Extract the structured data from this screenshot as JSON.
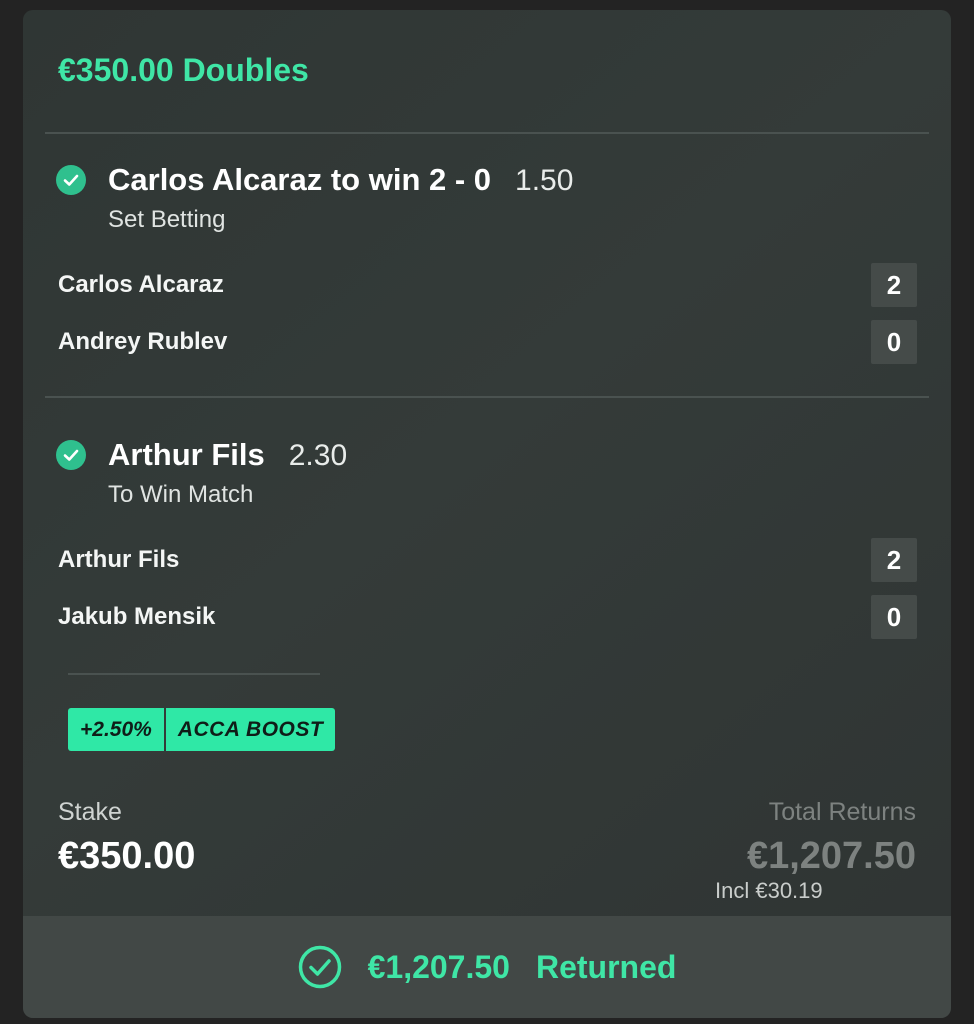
{
  "bet": {
    "title": "€350.00 Doubles",
    "selections": [
      {
        "name": "Carlos Alcaraz to win 2 - 0",
        "odds": "1.50",
        "market": "Set Betting",
        "status_icon": "check-circle-icon",
        "scores": [
          {
            "player": "Carlos Alcaraz",
            "score": "2"
          },
          {
            "player": "Andrey Rublev",
            "score": "0"
          }
        ]
      },
      {
        "name": "Arthur Fils",
        "odds": "2.30",
        "market": "To Win Match",
        "status_icon": "check-circle-icon",
        "scores": [
          {
            "player": "Arthur Fils",
            "score": "2"
          },
          {
            "player": "Jakub Mensik",
            "score": "0"
          }
        ]
      }
    ],
    "boost": {
      "percent": "+2.50%",
      "label": "ACCA BOOST"
    },
    "stake": {
      "label": "Stake",
      "value": "€350.00"
    },
    "returns": {
      "label": "Total Returns",
      "value": "€1,207.50",
      "incl": "Incl €30.19"
    },
    "footer": {
      "amount": "€1,207.50",
      "status": "Returned",
      "icon": "check-circle-outline-icon"
    }
  },
  "colors": {
    "accent": "#3fe6a6",
    "check": "#2fc08e",
    "card": "#323937",
    "background": "#232323",
    "footer": "#424846"
  }
}
